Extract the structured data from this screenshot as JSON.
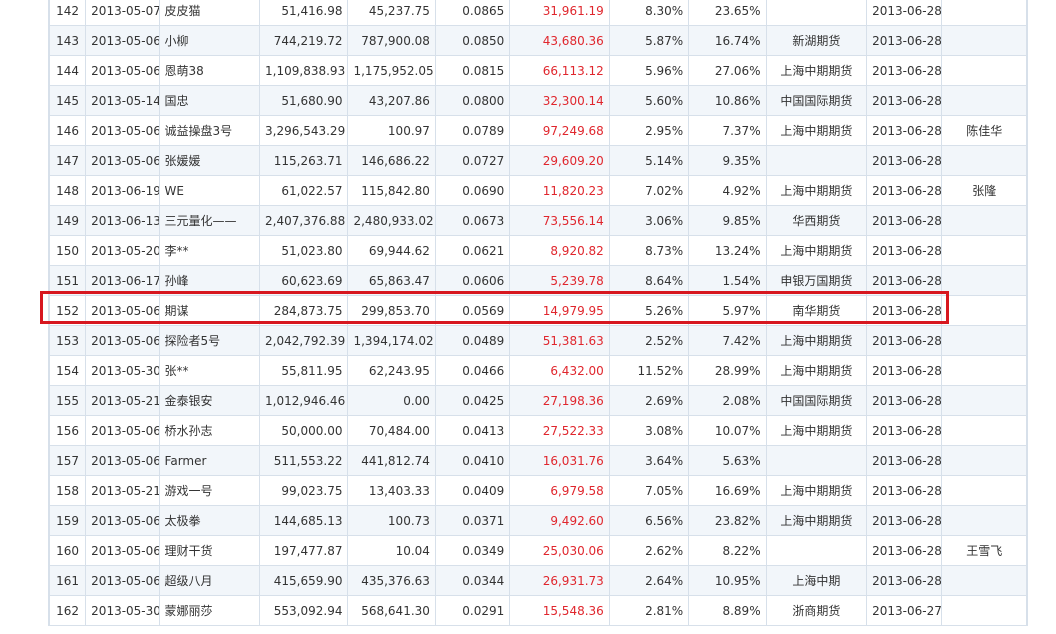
{
  "table": {
    "rows": [
      {
        "rank": "142",
        "date": "2013-05-07",
        "name": "皮皮猫",
        "capital": "51,416.98",
        "equity": "45,237.75",
        "ratio": "0.0865",
        "profit": "31,961.19",
        "pct1": "8.30%",
        "pct2": "23.65%",
        "broker": "",
        "updated": "2013-06-28",
        "note": ""
      },
      {
        "rank": "143",
        "date": "2013-05-06",
        "name": "小柳",
        "capital": "744,219.72",
        "equity": "787,900.08",
        "ratio": "0.0850",
        "profit": "43,680.36",
        "pct1": "5.87%",
        "pct2": "16.74%",
        "broker": "新湖期货",
        "updated": "2013-06-28",
        "note": ""
      },
      {
        "rank": "144",
        "date": "2013-05-06",
        "name": "恩萌38",
        "capital": "1,109,838.93",
        "equity": "1,175,952.05",
        "ratio": "0.0815",
        "profit": "66,113.12",
        "pct1": "5.96%",
        "pct2": "27.06%",
        "broker": "上海中期期货",
        "updated": "2013-06-28",
        "note": ""
      },
      {
        "rank": "145",
        "date": "2013-05-14",
        "name": "国忠",
        "capital": "51,680.90",
        "equity": "43,207.86",
        "ratio": "0.0800",
        "profit": "32,300.14",
        "pct1": "5.60%",
        "pct2": "10.86%",
        "broker": "中国国际期货",
        "updated": "2013-06-28",
        "note": ""
      },
      {
        "rank": "146",
        "date": "2013-05-06",
        "name": "诚益操盘3号",
        "capital": "3,296,543.29",
        "equity": "100.97",
        "ratio": "0.0789",
        "profit": "97,249.68",
        "pct1": "2.95%",
        "pct2": "7.37%",
        "broker": "上海中期期货",
        "updated": "2013-06-28",
        "note": "陈佳华"
      },
      {
        "rank": "147",
        "date": "2013-05-06",
        "name": "张媛媛",
        "capital": "115,263.71",
        "equity": "146,686.22",
        "ratio": "0.0727",
        "profit": "29,609.20",
        "pct1": "5.14%",
        "pct2": "9.35%",
        "broker": "",
        "updated": "2013-06-28",
        "note": ""
      },
      {
        "rank": "148",
        "date": "2013-06-19",
        "name": "WE",
        "capital": "61,022.57",
        "equity": "115,842.80",
        "ratio": "0.0690",
        "profit": "11,820.23",
        "pct1": "7.02%",
        "pct2": "4.92%",
        "broker": "上海中期期货",
        "updated": "2013-06-28",
        "note": "张隆"
      },
      {
        "rank": "149",
        "date": "2013-06-13",
        "name": "三元量化——",
        "capital": "2,407,376.88",
        "equity": "2,480,933.02",
        "ratio": "0.0673",
        "profit": "73,556.14",
        "pct1": "3.06%",
        "pct2": "9.85%",
        "broker": "华西期货",
        "updated": "2013-06-28",
        "note": ""
      },
      {
        "rank": "150",
        "date": "2013-05-20",
        "name": "李**",
        "capital": "51,023.80",
        "equity": "69,944.62",
        "ratio": "0.0621",
        "profit": "8,920.82",
        "pct1": "8.73%",
        "pct2": "13.24%",
        "broker": "上海中期期货",
        "updated": "2013-06-28",
        "note": ""
      },
      {
        "rank": "151",
        "date": "2013-06-17",
        "name": "孙峰",
        "capital": "60,623.69",
        "equity": "65,863.47",
        "ratio": "0.0606",
        "profit": "5,239.78",
        "pct1": "8.64%",
        "pct2": "1.54%",
        "broker": "申银万国期货",
        "updated": "2013-06-28",
        "note": ""
      },
      {
        "rank": "152",
        "date": "2013-05-06",
        "name": "期谋",
        "capital": "284,873.75",
        "equity": "299,853.70",
        "ratio": "0.0569",
        "profit": "14,979.95",
        "pct1": "5.26%",
        "pct2": "5.97%",
        "broker": "南华期货",
        "updated": "2013-06-28",
        "note": ""
      },
      {
        "rank": "153",
        "date": "2013-05-06",
        "name": "探险者5号",
        "capital": "2,042,792.39",
        "equity": "1,394,174.02",
        "ratio": "0.0489",
        "profit": "51,381.63",
        "pct1": "2.52%",
        "pct2": "7.42%",
        "broker": "上海中期期货",
        "updated": "2013-06-28",
        "note": ""
      },
      {
        "rank": "154",
        "date": "2013-05-30",
        "name": "张**",
        "capital": "55,811.95",
        "equity": "62,243.95",
        "ratio": "0.0466",
        "profit": "6,432.00",
        "pct1": "11.52%",
        "pct2": "28.99%",
        "broker": "上海中期期货",
        "updated": "2013-06-28",
        "note": ""
      },
      {
        "rank": "155",
        "date": "2013-05-21",
        "name": "金泰银安",
        "capital": "1,012,946.46",
        "equity": "0.00",
        "ratio": "0.0425",
        "profit": "27,198.36",
        "pct1": "2.69%",
        "pct2": "2.08%",
        "broker": "中国国际期货",
        "updated": "2013-06-28",
        "note": ""
      },
      {
        "rank": "156",
        "date": "2013-05-06",
        "name": "桥水孙志",
        "capital": "50,000.00",
        "equity": "70,484.00",
        "ratio": "0.0413",
        "profit": "27,522.33",
        "pct1": "3.08%",
        "pct2": "10.07%",
        "broker": "上海中期期货",
        "updated": "2013-06-28",
        "note": ""
      },
      {
        "rank": "157",
        "date": "2013-05-06",
        "name": "Farmer",
        "capital": "511,553.22",
        "equity": "441,812.74",
        "ratio": "0.0410",
        "profit": "16,031.76",
        "pct1": "3.64%",
        "pct2": "5.63%",
        "broker": "",
        "updated": "2013-06-28",
        "note": ""
      },
      {
        "rank": "158",
        "date": "2013-05-21",
        "name": "游戏一号",
        "capital": "99,023.75",
        "equity": "13,403.33",
        "ratio": "0.0409",
        "profit": "6,979.58",
        "pct1": "7.05%",
        "pct2": "16.69%",
        "broker": "上海中期期货",
        "updated": "2013-06-28",
        "note": ""
      },
      {
        "rank": "159",
        "date": "2013-05-06",
        "name": "太极拳",
        "capital": "144,685.13",
        "equity": "100.73",
        "ratio": "0.0371",
        "profit": "9,492.60",
        "pct1": "6.56%",
        "pct2": "23.82%",
        "broker": "上海中期期货",
        "updated": "2013-06-28",
        "note": ""
      },
      {
        "rank": "160",
        "date": "2013-05-06",
        "name": "理财干货",
        "capital": "197,477.87",
        "equity": "10.04",
        "ratio": "0.0349",
        "profit": "25,030.06",
        "pct1": "2.62%",
        "pct2": "8.22%",
        "broker": "",
        "updated": "2013-06-28",
        "note": "王雪飞"
      },
      {
        "rank": "161",
        "date": "2013-05-06",
        "name": "超级八月",
        "capital": "415,659.90",
        "equity": "435,376.63",
        "ratio": "0.0344",
        "profit": "26,931.73",
        "pct1": "2.64%",
        "pct2": "10.95%",
        "broker": "上海中期",
        "updated": "2013-06-28",
        "note": ""
      },
      {
        "rank": "162",
        "date": "2013-05-30",
        "name": "蒙娜丽莎",
        "capital": "553,092.94",
        "equity": "568,641.30",
        "ratio": "0.0291",
        "profit": "15,548.36",
        "pct1": "2.81%",
        "pct2": "8.89%",
        "broker": "浙商期货",
        "updated": "2013-06-27",
        "note": ""
      }
    ]
  },
  "colors": {
    "profit_red": "#e0262d",
    "highlight_border": "#d7171f",
    "grid_line": "#d7e0ea",
    "row_alt_bg": "#f2f6fa"
  }
}
